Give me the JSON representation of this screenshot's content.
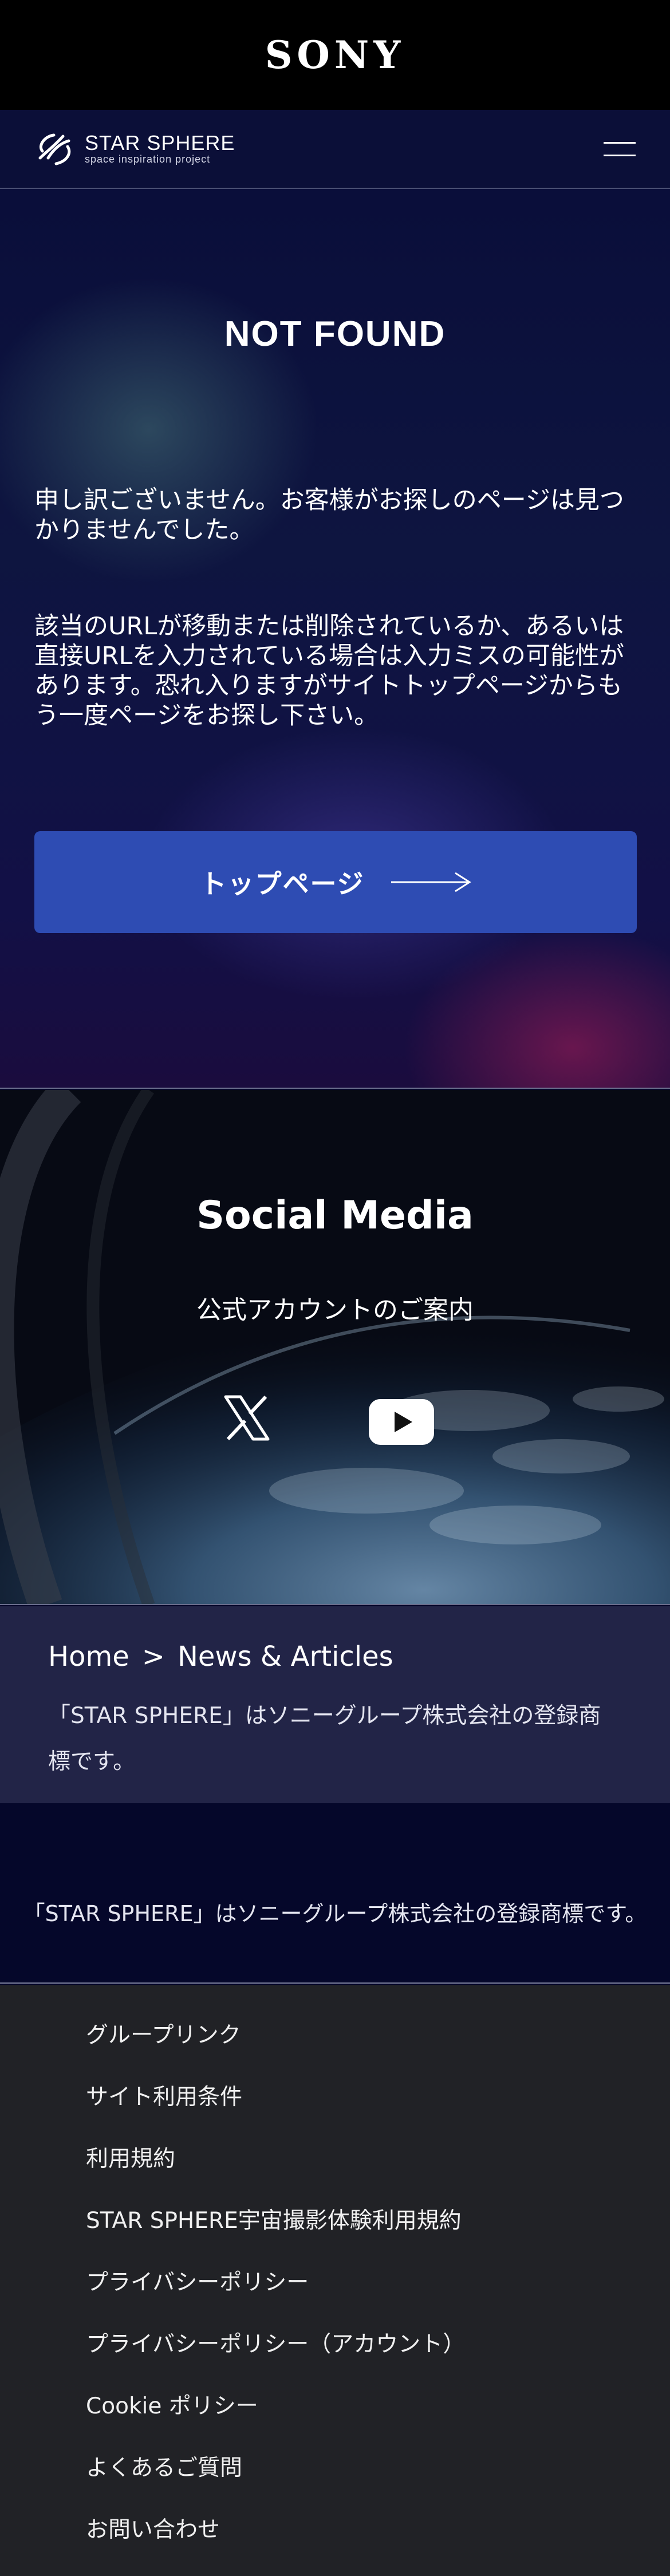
{
  "sony_bar": {
    "logo": "SONY"
  },
  "header": {
    "brand_name": "STAR SPHERE",
    "brand_sub": "space inspiration project"
  },
  "hero": {
    "title": "NOT FOUND",
    "paragraph1": "申し訳ございません。お客様がお探しのページは見つかりませんでした。",
    "paragraph2": "該当のURLが移動または削除されているか、あるいは直接URLを入力されている場合は入力ミスの可能性があります。恐れ入りますがサイトトップページからもう一度ページをお探し下さい。",
    "button_label": "トップページ"
  },
  "social": {
    "title": "Social Media",
    "subtitle": "公式アカウントのご案内",
    "icons": [
      "x-icon",
      "youtube-icon"
    ]
  },
  "breadcrumb": {
    "home": "Home",
    "separator": ">",
    "current": "News & Articles",
    "note": "「STAR SPHERE」はソニーグループ株式会社の登録商標です。"
  },
  "trademark": {
    "text": "「STAR SPHERE」はソニーグループ株式会社の登録商標です。"
  },
  "footer": {
    "items": [
      "グループリンク",
      "サイト利用条件",
      "利用規約",
      "STAR SPHERE宇宙撮影体験利用規約",
      "プライバシーポリシー",
      "プライバシーポリシー（アカウント）",
      "Cookie ポリシー",
      "よくあるご質問",
      "お問い合わせ"
    ]
  }
}
